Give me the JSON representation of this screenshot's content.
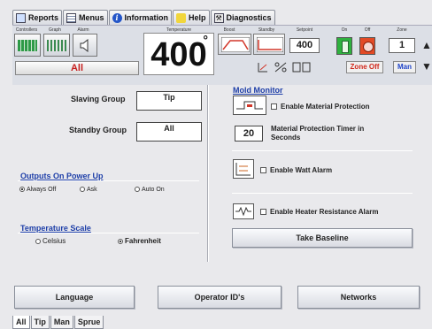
{
  "menu": {
    "tabs": [
      {
        "label": "Reports",
        "icon": "reports-icon"
      },
      {
        "label": "Menus",
        "icon": "menus-icon"
      },
      {
        "label": "Information",
        "icon": "information-icon"
      },
      {
        "label": "Help",
        "icon": "help-icon"
      },
      {
        "label": "Diagnostics",
        "icon": "diagnostics-icon"
      }
    ]
  },
  "header": {
    "labels": {
      "controllers": "Controllers",
      "graph": "Graph",
      "alarm": "Alarm",
      "temperature": "Temperature",
      "boost": "Boost",
      "standby": "Standby",
      "setpoint": "Setpoint",
      "on": "On",
      "off": "Off",
      "zone": "Zone"
    },
    "zone_group": "All",
    "temperature": "400",
    "temperature_unit": "°",
    "setpoint": "400",
    "zone_number": "1",
    "zone_off_label": "Zone Off",
    "mode_label": "Man",
    "colors": {
      "accent_red": "#c61d1d",
      "man_blue": "#1e43c9",
      "on_green": "#2fb13f",
      "off_red": "#e24a25"
    }
  },
  "left": {
    "slaving_group_label": "Slaving Group",
    "slaving_group_value": "Tip",
    "standby_group_label": "Standby Group",
    "standby_group_value": "All",
    "outputs_title": "Outputs On Power Up",
    "outputs_options": [
      "Always Off",
      "Ask",
      "Auto On"
    ],
    "outputs_selected": "Always Off",
    "temp_scale_title": "Temperature Scale",
    "temp_scale_options": [
      "Celsius",
      "Fahrenheit"
    ],
    "temp_scale_selected": "Fahrenheit"
  },
  "right": {
    "mold_monitor_title": "Mold Monitor",
    "enable_material_protection": "Enable Material Protection",
    "timer_value": "20",
    "timer_label": "Material Protection Timer in Seconds",
    "enable_watt_alarm": "Enable Watt Alarm",
    "enable_heater_resistance_alarm": "Enable Heater Resistance Alarm",
    "take_baseline": "Take Baseline"
  },
  "bottom_buttons": {
    "language": "Language",
    "operator_ids": "Operator ID's",
    "networks": "Networks"
  },
  "bottom_tabs": [
    "All",
    "Tip",
    "Man",
    "Sprue"
  ]
}
